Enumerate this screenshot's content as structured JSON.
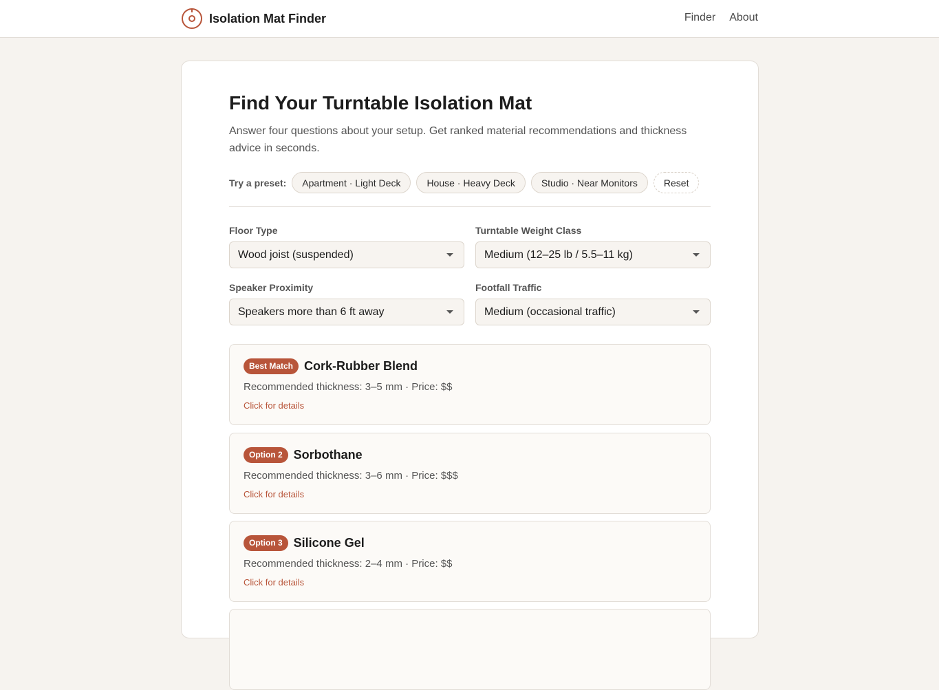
{
  "header": {
    "brand": "Isolation Mat Finder",
    "nav": [
      "Finder",
      "About"
    ]
  },
  "page": {
    "title": "Find Your Turntable Isolation Mat",
    "intro": "Answer four questions about your setup. Get ranked material recommendations and thickness advice in seconds."
  },
  "presets": {
    "label": "Try a preset:",
    "items": [
      "Apartment · Light Deck",
      "House · Heavy Deck",
      "Studio · Near Monitors"
    ],
    "reset": "Reset"
  },
  "form": {
    "floor_type": {
      "label": "Floor Type",
      "value": "Wood joist (suspended)"
    },
    "weight_class": {
      "label": "Turntable Weight Class",
      "value": "Medium (12–25 lb / 5.5–11 kg)"
    },
    "speaker_proximity": {
      "label": "Speaker Proximity",
      "value": "Speakers more than 6 ft away"
    },
    "footfall": {
      "label": "Footfall Traffic",
      "value": "Medium (occasional traffic)"
    }
  },
  "results": [
    {
      "badge": "Best Match",
      "name": "Cork-Rubber Blend",
      "meta": "Recommended thickness: 3–5 mm · Price: $$",
      "details": "Click for details"
    },
    {
      "badge": "Option 2",
      "name": "Sorbothane",
      "meta": "Recommended thickness: 3–6 mm · Price: $$$",
      "details": "Click for details"
    },
    {
      "badge": "Option 3",
      "name": "Silicone Gel",
      "meta": "Recommended thickness: 2–4 mm · Price: $$",
      "details": "Click for details"
    }
  ],
  "colors": {
    "accent": "#b8553a",
    "background": "#f6f3ef"
  },
  "icons": {
    "brand": "turntable-record-icon"
  }
}
